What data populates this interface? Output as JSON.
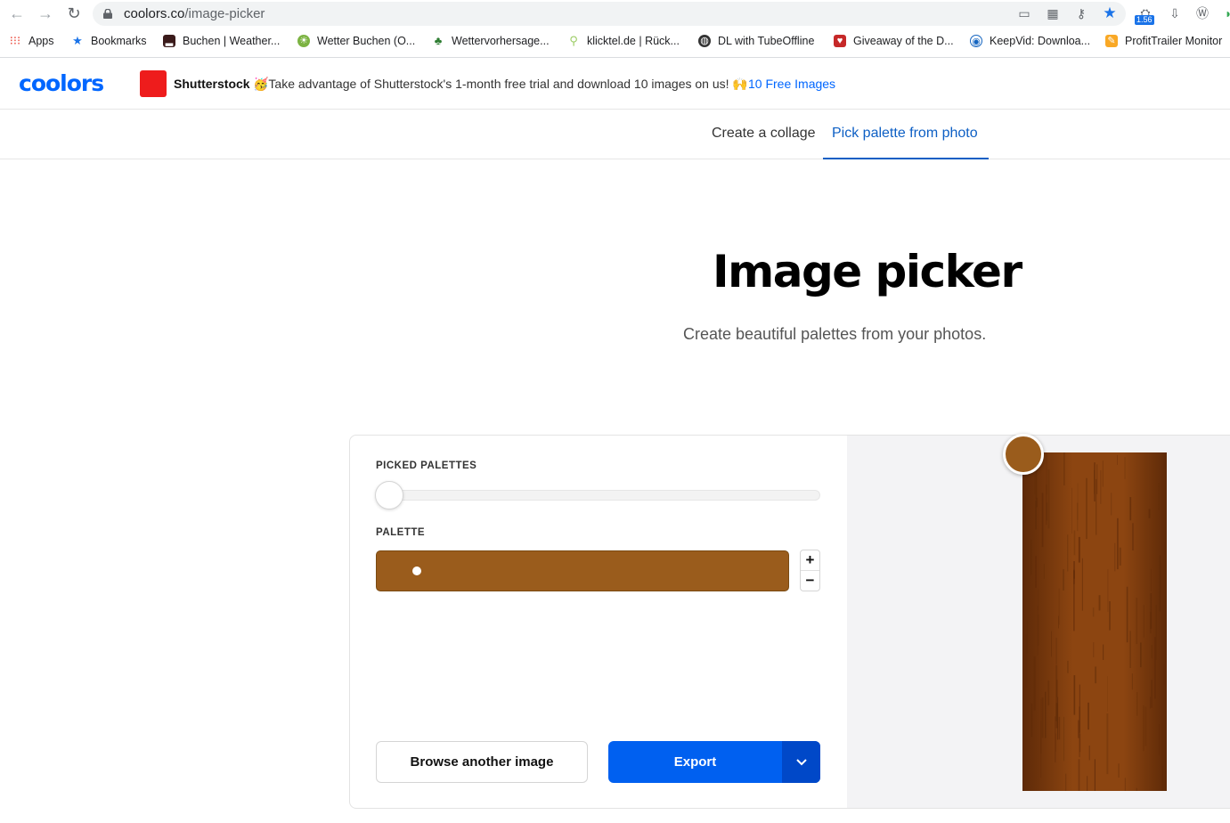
{
  "browser": {
    "url_host": "coolors.co",
    "url_path": "/image-picker",
    "ext_badge": "1.56",
    "bookmarks": [
      {
        "label": "Apps",
        "icon": "apps-grid-icon",
        "color": "#ea4335"
      },
      {
        "label": "Bookmarks",
        "icon": "star-icon",
        "color": "#1a73e8"
      },
      {
        "label": "Buchen | Weather...",
        "icon": "weather-chart-icon",
        "color": "#b33"
      },
      {
        "label": "Wetter Buchen (O...",
        "icon": "weather-sun-icon",
        "color": "#7cb342"
      },
      {
        "label": "Wettervorhersage...",
        "icon": "palm-tree-icon",
        "color": "#2e7d32"
      },
      {
        "label": "klicktel.de | Rück...",
        "icon": "magnifier-icon",
        "color": "#9ccc65"
      },
      {
        "label": "DL with TubeOffline",
        "icon": "globe-icon",
        "color": "#333"
      },
      {
        "label": "Giveaway of the D...",
        "icon": "gift-icon",
        "color": "#c62828"
      },
      {
        "label": "KeepVid: Downloa...",
        "icon": "keepvid-icon",
        "color": "#1565c0"
      },
      {
        "label": "ProfitTrailer Monitor",
        "icon": "profittrailer-icon",
        "color": "#f9a825"
      }
    ]
  },
  "header": {
    "logo": "coolors",
    "ad_brand": "Shutterstock",
    "ad_text": "🥳Take advantage of Shutterstock's 1-month free trial and download 10 images on us! 🙌",
    "ad_link": "10 Free Images"
  },
  "tabs": [
    {
      "label": "Create a collage",
      "active": false
    },
    {
      "label": "Pick palette from photo",
      "active": true
    }
  ],
  "hero": {
    "title": "Image picker",
    "subtitle": "Create beautiful palettes from your photos."
  },
  "picker": {
    "picked_palettes_label": "PICKED PALETTES",
    "palette_label": "PALETTE",
    "palette_colors": [
      "#9a5c1c"
    ],
    "slider_value": 0,
    "plus": "+",
    "minus": "−",
    "browse_label": "Browse another image",
    "export_label": "Export"
  },
  "image": {
    "picked_color": "#9a5c1c",
    "wood_light": "#8c4511",
    "wood_dark": "#5e2a08"
  }
}
